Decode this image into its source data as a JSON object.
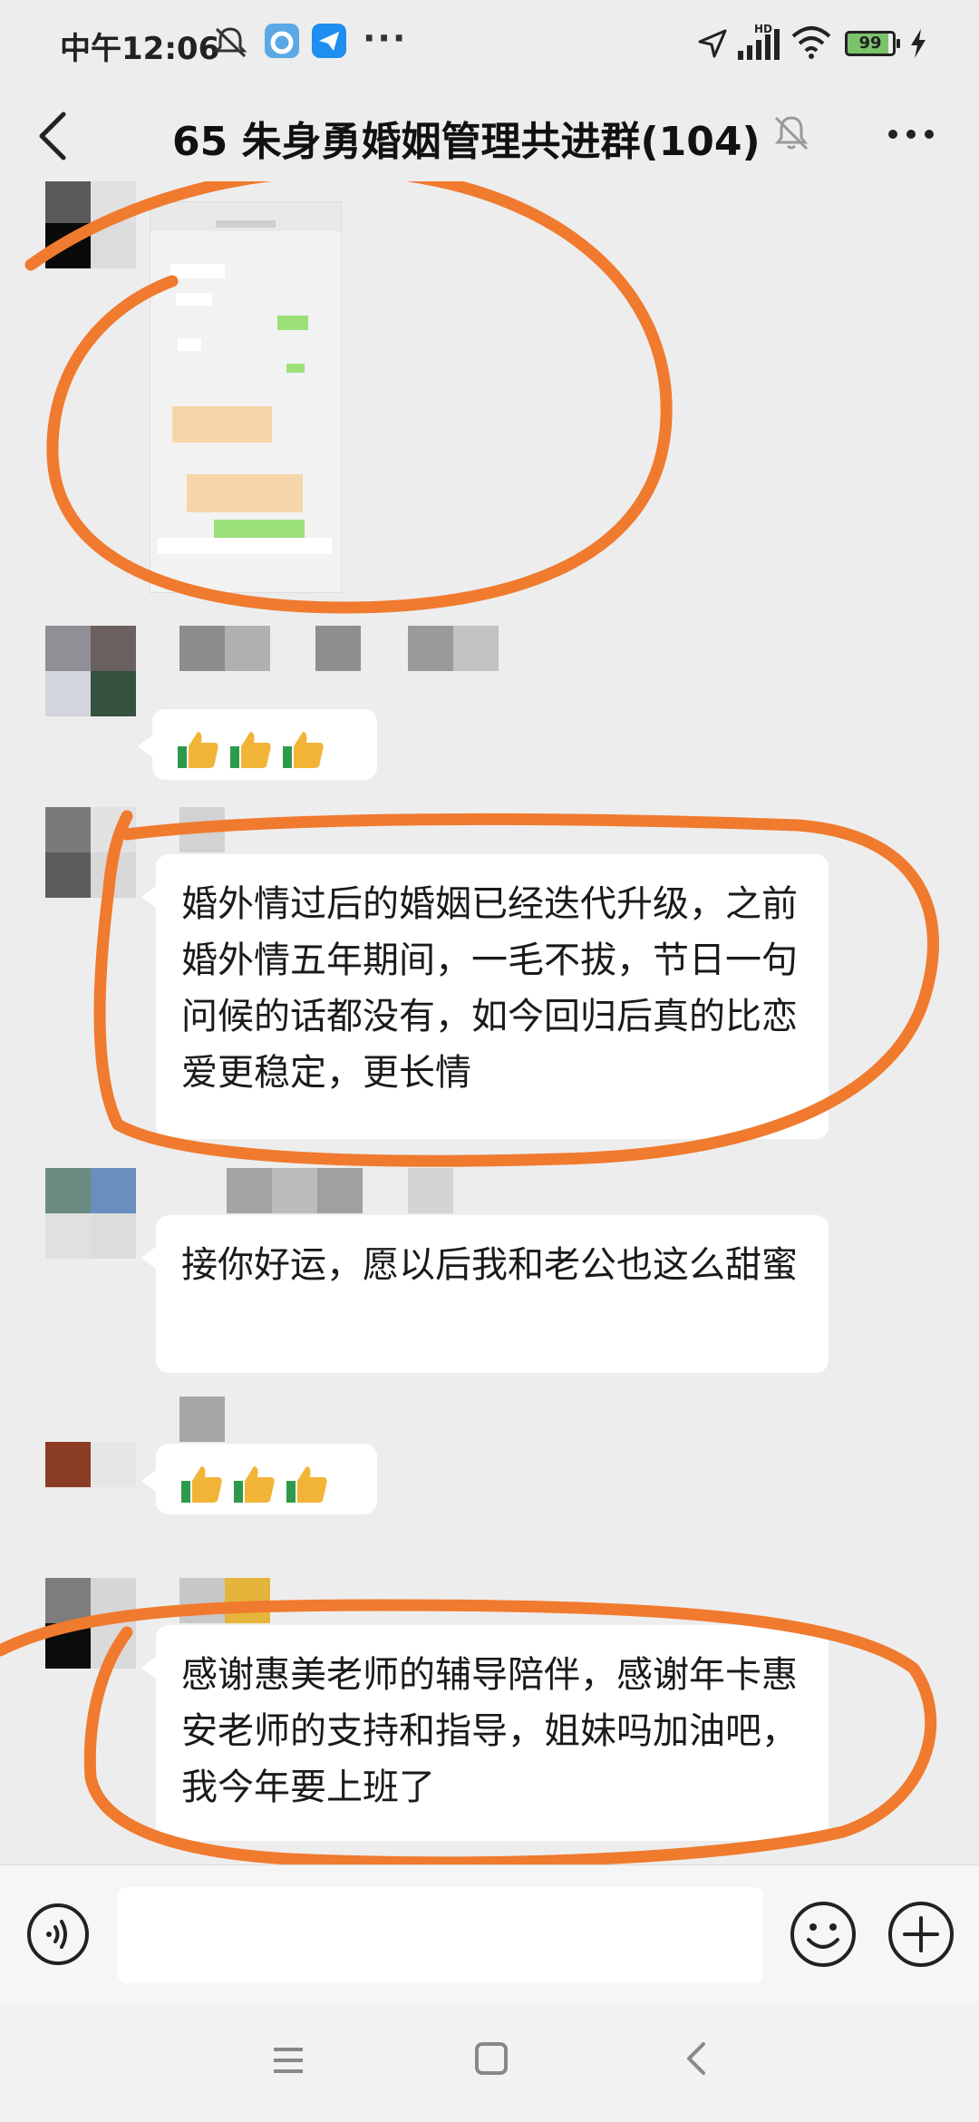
{
  "status_bar": {
    "time": "中午12:06",
    "more": "···",
    "battery": "99",
    "network_label": "HD"
  },
  "title_bar": {
    "title": "65 朱身勇婚姻管理共进群(104)",
    "icons": [
      "back-arrow-icon",
      "bell-off-icon",
      "more-dots-icon"
    ]
  },
  "messages": [
    {
      "type": "image",
      "description_icon": "screenshot-thumbnail"
    },
    {
      "type": "emoji",
      "content": "thumbs-up x3"
    },
    {
      "type": "text",
      "text": "婚外情过后的婚姻已经迭代升级，之前婚外情五年期间，一毛不拔，节日一句问候的话都没有，如今回归后真的比恋爱更稳定，更长情"
    },
    {
      "type": "text",
      "text": "接你好运，愿以后我和老公也这么甜蜜"
    },
    {
      "type": "emoji",
      "content": "thumbs-up x3"
    },
    {
      "type": "text",
      "text": "感谢惠美老师的辅导陪伴，感谢年卡惠安老师的支持和指导，姐妹吗加油吧，我今年要上班了"
    }
  ],
  "colors": {
    "background": "#ededed",
    "bubble": "#ffffff",
    "annotation_circle": "#f07a2e"
  },
  "input_bar": {
    "placeholder": "",
    "icons": [
      "voice-icon",
      "emoji-icon",
      "plus-icon"
    ]
  },
  "nav_bar": {
    "icons": [
      "menu-icon",
      "home-icon",
      "back-icon"
    ]
  }
}
